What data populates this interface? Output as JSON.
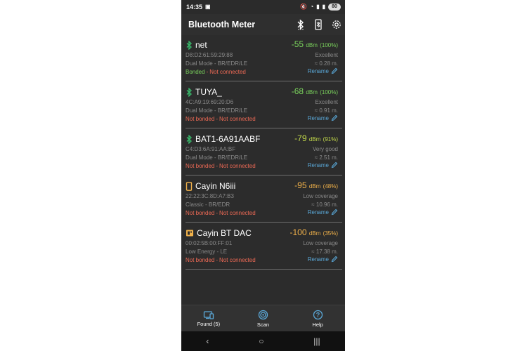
{
  "status_bar": {
    "time": "14:35",
    "battery": "80"
  },
  "app_bar": {
    "title": "Bluetooth Meter"
  },
  "devices": [
    {
      "name": "net",
      "icon": "bluetooth-icon",
      "icon_color": "#39b86a",
      "rssi": "-55",
      "unit": "dBm",
      "percent": "(100%)",
      "rssi_color": "#7ad25c",
      "mac": "D8:D2:61:59:29:88",
      "quality": "Excellent",
      "mode": "Dual Mode - BR/EDR/LE",
      "distance": "≈ 0.28 m.",
      "bonded": "Bonded",
      "bonded_state": "yes",
      "separator": "-",
      "connection": "Not connected",
      "rename": "Rename"
    },
    {
      "name": "TUYA_",
      "icon": "bluetooth-icon",
      "icon_color": "#39b86a",
      "rssi": "-68",
      "unit": "dBm",
      "percent": "(100%)",
      "rssi_color": "#7ad25c",
      "mac": "4C:A9:19:69:20:D6",
      "quality": "Excellent",
      "mode": "Dual Mode - BR/EDR/LE",
      "distance": "≈ 0.91 m.",
      "bonded": "Not bonded",
      "bonded_state": "no",
      "separator": "-",
      "connection": "Not connected",
      "rename": "Rename"
    },
    {
      "name": "BAT1-6A91AABF",
      "icon": "bluetooth-icon",
      "icon_color": "#39b86a",
      "rssi": "-79",
      "unit": "dBm",
      "percent": "(91%)",
      "rssi_color": "#c2d94a",
      "mac": "C4:D3:6A:91:AA:BF",
      "quality": "Very good",
      "mode": "Dual Mode - BR/EDR/LE",
      "distance": "≈ 2.51 m.",
      "bonded": "Not bonded",
      "bonded_state": "no",
      "separator": "-",
      "connection": "Not connected",
      "rename": "Rename"
    },
    {
      "name": "Cayin N6iii",
      "icon": "phone-icon",
      "icon_color": "#f0b14a",
      "rssi": "-95",
      "unit": "dBm",
      "percent": "(48%)",
      "rssi_color": "#f0b14a",
      "mac": "22:22:3C:8D:A7:B3",
      "quality": "Low coverage",
      "mode": "Classic - BR/EDR",
      "distance": "≈ 10.96 m.",
      "bonded": "Not bonded",
      "bonded_state": "no",
      "separator": "-",
      "connection": "Not connected",
      "rename": "Rename"
    },
    {
      "name": "Cayin BT DAC",
      "icon": "chip-icon",
      "icon_color": "#f0b14a",
      "rssi": "-100",
      "unit": "dBm",
      "percent": "(35%)",
      "rssi_color": "#f0b14a",
      "mac": "00:02:5B:00:FF:01",
      "quality": "Low coverage",
      "mode": "Low Energy - LE",
      "distance": "≈ 17.38 m.",
      "bonded": "Not bonded",
      "bonded_state": "no",
      "separator": "-",
      "connection": "Not connected",
      "rename": "Rename"
    }
  ],
  "bottom_nav": [
    {
      "label": "Found (5)",
      "icon": "devices-icon"
    },
    {
      "label": "Scan",
      "icon": "scan-icon"
    },
    {
      "label": "Help",
      "icon": "help-icon"
    }
  ],
  "colors": {
    "accent": "#5aa8d8",
    "not_connected": "#ef6a55",
    "bonded": "#7ad25c"
  }
}
